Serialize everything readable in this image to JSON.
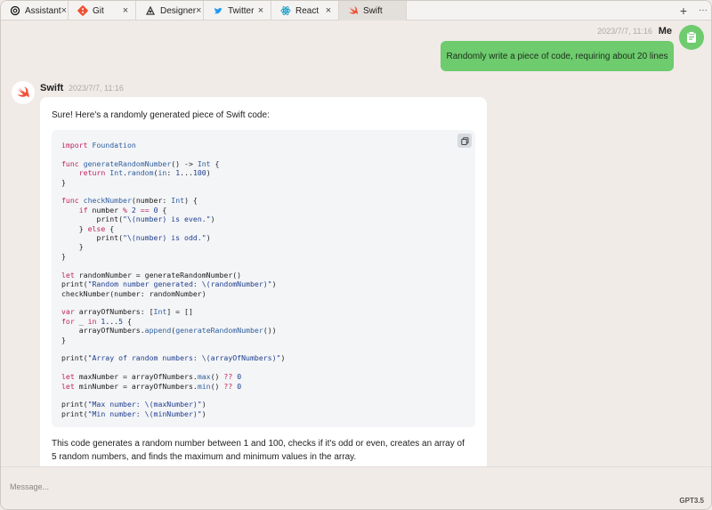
{
  "tabs": [
    {
      "label": "Assistant",
      "icon": "openai-icon",
      "active": false
    },
    {
      "label": "Git",
      "icon": "git-icon",
      "active": false
    },
    {
      "label": "Designer",
      "icon": "designer-icon",
      "active": false
    },
    {
      "label": "Twitter",
      "icon": "twitter-icon",
      "active": false
    },
    {
      "label": "React",
      "icon": "react-icon",
      "active": false
    },
    {
      "label": "Swift",
      "icon": "swift-icon",
      "active": true
    }
  ],
  "tabbar": {
    "add": "+",
    "more": "···",
    "close": "×"
  },
  "user_msg": {
    "name": "Me",
    "time": "2023/7/7, 11:16",
    "text": "Randomly write a piece of code, requiring about 20 lines"
  },
  "bot_msg": {
    "name": "Swift",
    "time": "2023/7/7, 11:16",
    "intro": "Sure! Here's a randomly generated piece of Swift code:",
    "outro": "This code generates a random number between 1 and 100, checks if it's odd or even, creates an array of 5 random numbers, and finds the maximum and minimum values in the array."
  },
  "input": {
    "placeholder": "Message..."
  },
  "model": "GPT3.5",
  "colors": {
    "accent_green": "#6ecb6e",
    "swift_orange": "#f05138",
    "twitter_blue": "#1d9bf0",
    "react_cyan": "#149eca",
    "git_red": "#f05033"
  }
}
